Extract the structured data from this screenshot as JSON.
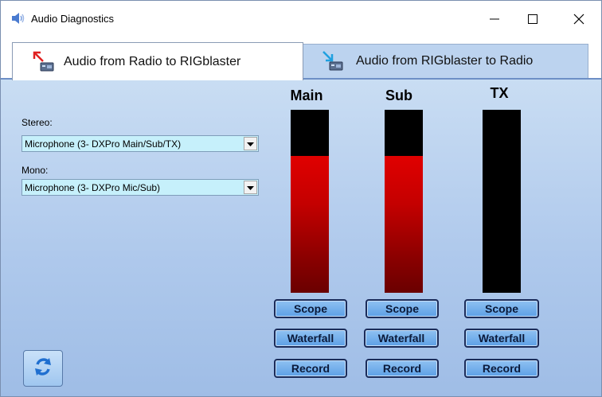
{
  "window": {
    "title": "Audio Diagnostics"
  },
  "tabs": [
    {
      "label": "Audio from Radio to RIGblaster",
      "active": true
    },
    {
      "label": "Audio from RIGblaster to Radio",
      "active": false
    }
  ],
  "inputs": {
    "stereo": {
      "label": "Stereo:",
      "value": "Microphone (3- DXPro Main/Sub/TX)"
    },
    "mono": {
      "label": "Mono:",
      "value": "Microphone (3- DXPro Mic/Sub)"
    }
  },
  "meters": [
    {
      "title": "Main",
      "level": 0.75,
      "buttons": {
        "scope": "Scope",
        "waterfall": "Waterfall",
        "record": "Record"
      }
    },
    {
      "title": "Sub",
      "level": 0.75,
      "buttons": {
        "scope": "Scope",
        "waterfall": "Waterfall",
        "record": "Record"
      }
    },
    {
      "title": "TX",
      "level": 0.0,
      "buttons": {
        "scope": "Scope",
        "waterfall": "Waterfall",
        "record": "Record"
      }
    }
  ],
  "colors": {
    "panel": "#afc9ec",
    "meter_fill": "#c40000",
    "button": "#5da0e6",
    "combo": "#c6f0fb"
  },
  "icons": {
    "app": "speaker-icon",
    "refresh": "refresh-icon",
    "minimize": "minimize-icon",
    "maximize": "maximize-icon",
    "close": "close-icon"
  }
}
